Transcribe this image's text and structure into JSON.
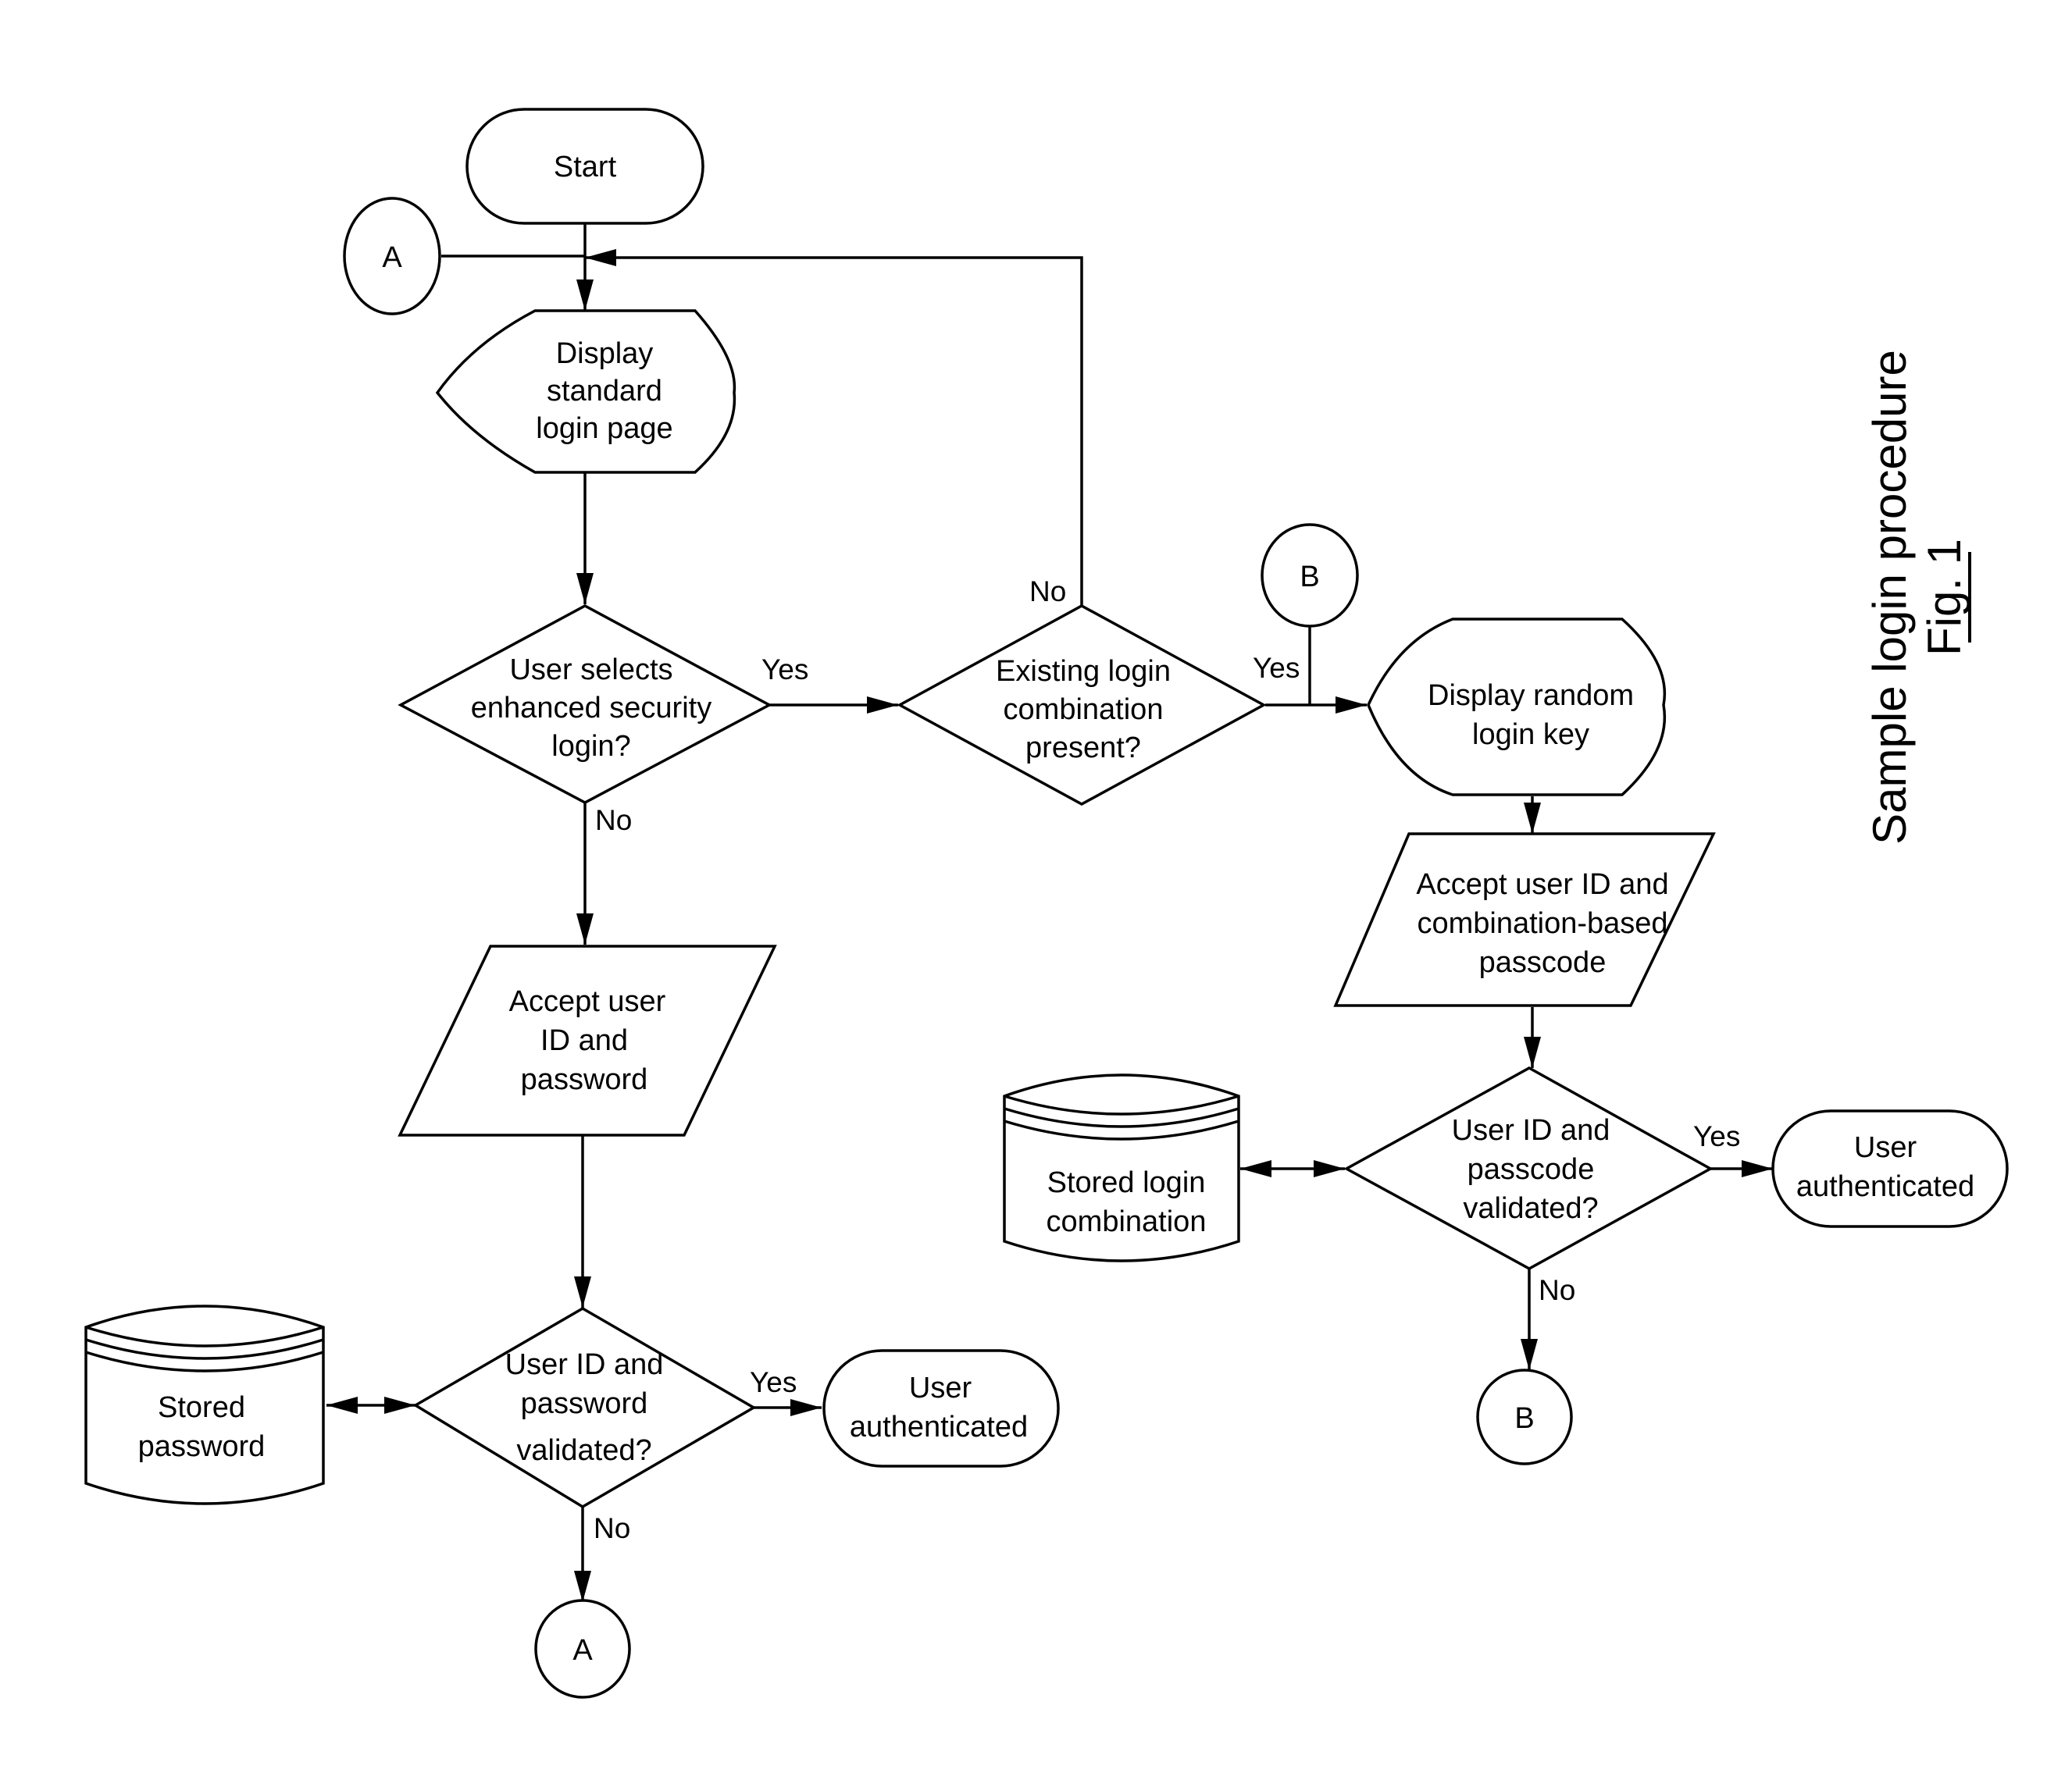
{
  "figure": {
    "title": "Sample login procedure",
    "fig_label": "Fig. 1"
  },
  "nodes": {
    "start": "Start",
    "connector_a_top": "A",
    "display_standard": [
      "Display",
      "standard",
      "login page"
    ],
    "decision_enhanced": [
      "User selects",
      "enhanced security",
      "login?"
    ],
    "decision_existing": [
      "Existing login",
      "combination",
      "present?"
    ],
    "connector_b_top": "B",
    "display_random": [
      "Display random",
      "login key"
    ],
    "accept_combination": [
      "Accept user ID and",
      "combination-based",
      "passcode"
    ],
    "stored_combination": [
      "Stored login",
      "combination"
    ],
    "decision_passcode": [
      "User ID and",
      "passcode",
      "validated?"
    ],
    "auth_right": [
      "User",
      "authenticated"
    ],
    "connector_b_bottom": "B",
    "accept_password": [
      "Accept user",
      "ID and",
      "password"
    ],
    "stored_password": [
      "Stored",
      "password"
    ],
    "decision_password": [
      "User ID and",
      "password",
      "validated?"
    ],
    "auth_left": [
      "User",
      "authenticated"
    ],
    "connector_a_bottom": "A"
  },
  "edge_labels": {
    "enhanced_yes": "Yes",
    "enhanced_no": "No",
    "existing_no": "No",
    "existing_yes": "Yes",
    "passcode_yes": "Yes",
    "passcode_no": "No",
    "password_yes": "Yes",
    "password_no": "No"
  }
}
